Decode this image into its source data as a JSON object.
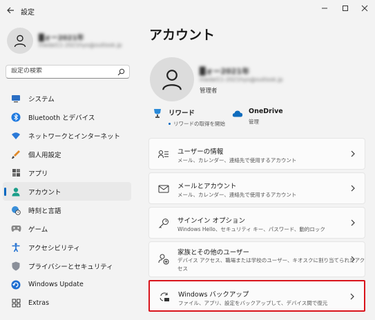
{
  "window": {
    "title": "設定"
  },
  "sidebar": {
    "user": {
      "name": "█ォー2021年",
      "email": "medal11-2021hyo@outlook.jp"
    },
    "search": {
      "placeholder": "設定の検索"
    },
    "items": [
      {
        "label": "システム",
        "icon": "system-display-icon",
        "selected": false
      },
      {
        "label": "Bluetooth とデバイス",
        "icon": "bluetooth-icon",
        "selected": false
      },
      {
        "label": "ネットワークとインターネット",
        "icon": "wifi-icon",
        "selected": false
      },
      {
        "label": "個人用設定",
        "icon": "brush-icon",
        "selected": false
      },
      {
        "label": "アプリ",
        "icon": "apps-icon",
        "selected": false
      },
      {
        "label": "アカウント",
        "icon": "account-person-icon",
        "selected": true
      },
      {
        "label": "時刻と言語",
        "icon": "globe-clock-icon",
        "selected": false
      },
      {
        "label": "ゲーム",
        "icon": "game-controller-icon",
        "selected": false
      },
      {
        "label": "アクセシビリティ",
        "icon": "accessibility-icon",
        "selected": false
      },
      {
        "label": "プライバシーとセキュリティ",
        "icon": "shield-icon",
        "selected": false
      },
      {
        "label": "Windows Update",
        "icon": "windows-update-icon",
        "selected": false
      },
      {
        "label": "Extras",
        "icon": "extras-grid-icon",
        "selected": false
      }
    ]
  },
  "main": {
    "title": "アカウント",
    "user": {
      "name": "█ォー2021年",
      "email": "medal11-2021hyo@outlook.jp",
      "role": "管理者"
    },
    "rewards": {
      "title": "リワード",
      "subtitle": "リワードの取得を開始"
    },
    "onedrive": {
      "title": "OneDrive",
      "subtitle": "管理"
    },
    "cards": [
      {
        "title": "ユーザーの情報",
        "desc": "メール、カレンダー、連絡先で使用するアカウント",
        "desc2": "",
        "icon": "user-info-icon"
      },
      {
        "title": "メールとアカウント",
        "desc": "メール、カレンダー、連絡先で使用するアカウント",
        "desc2": "",
        "icon": "mail-icon"
      },
      {
        "title": "サインイン オプション",
        "desc": "Windows Hello、セキュリティ キー、パスワード、動的ロック",
        "desc2": "",
        "icon": "key-icon"
      },
      {
        "title": "家族とその他のユーザー",
        "desc": "デバイス アクセス、職場または学校のユーザー、キオスクに割り当てられたアク",
        "desc2": "セス",
        "icon": "family-users-icon"
      },
      {
        "title": "Windows バックアップ",
        "desc": "ファイル、アプリ、設定をバックアップして、デバイス間で復元",
        "desc2": "",
        "icon": "backup-icon"
      }
    ]
  },
  "colors": {
    "accent": "#0067c0",
    "highlight_border": "#d9141c",
    "background": "#f3f3f3"
  }
}
